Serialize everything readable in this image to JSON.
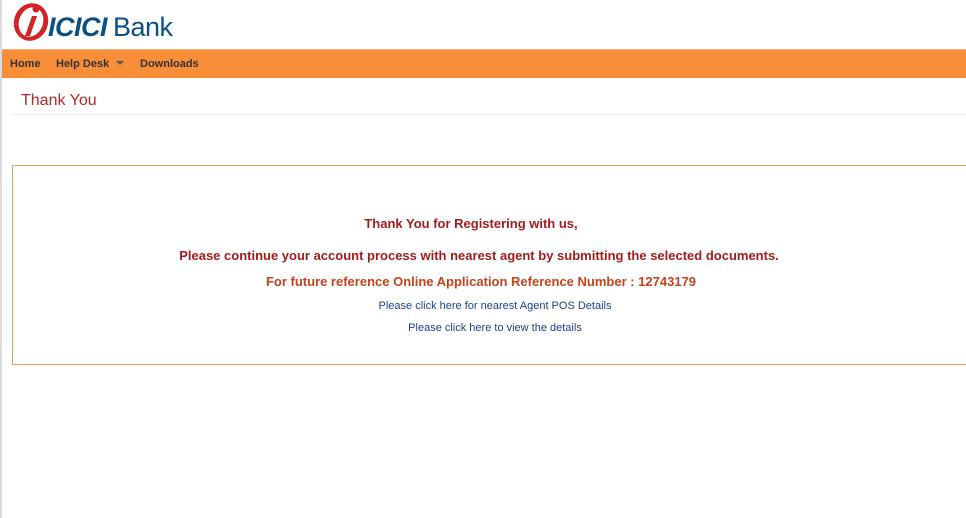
{
  "header": {
    "logo_text": "ICICI",
    "logo_bank": "Bank"
  },
  "nav": {
    "items": [
      {
        "label": "Home"
      },
      {
        "label": "Help Desk"
      },
      {
        "label": "Downloads"
      }
    ]
  },
  "page": {
    "title": "Thank You"
  },
  "message": {
    "line1": "Thank You for Registering with us,",
    "line2": "Please continue your account process with nearest agent by submitting the selected documents.",
    "line3": "For future reference Online Application Reference Number : 12743179",
    "link_agent": "Please click here for nearest Agent POS Details",
    "link_details": "Please click here to view the details"
  },
  "colors": {
    "nav_bg": "#f98e38",
    "title_red": "#b02a2a",
    "message_red": "#a31c1c",
    "reference_orange": "#c4431d",
    "link_blue": "#1a3f9a",
    "logo_blue": "#0a4f86",
    "logo_red": "#d2232a"
  },
  "icons": {
    "logo": "icici-i-logo-icon",
    "help_desk_dropdown": "caret-down-icon"
  }
}
